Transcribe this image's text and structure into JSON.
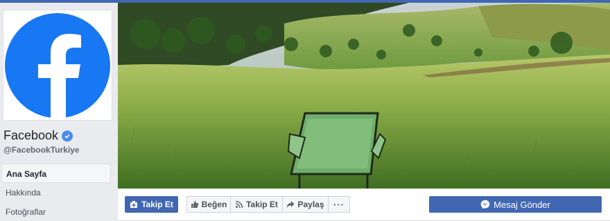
{
  "page": {
    "name": "Facebook",
    "handle": "@FacebookTurkiye"
  },
  "nav": {
    "items": [
      {
        "label": "Ana Sayfa"
      },
      {
        "label": "Hakkında"
      },
      {
        "label": "Fotoğraflar"
      }
    ]
  },
  "actions": {
    "follow_label": "Takip Et",
    "like_label": "Beğen",
    "follow_secondary_label": "Takip Et",
    "share_label": "Paylaş",
    "more_label": "···",
    "message_label": "Mesaj Gönder"
  },
  "colors": {
    "brand": "#1877f2",
    "button_blue": "#4267b2",
    "verified": "#4a8cf0"
  },
  "icons": [
    "facebook-logo-icon",
    "verified-badge-icon",
    "follow-plus-icon",
    "like-thumb-icon",
    "rss-icon",
    "share-arrow-icon",
    "more-dots-icon",
    "messenger-icon"
  ]
}
